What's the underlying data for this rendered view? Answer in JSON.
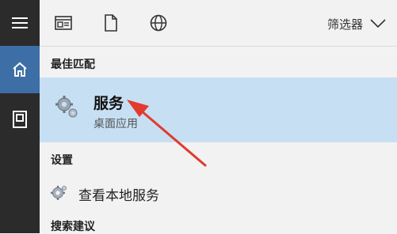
{
  "filter": {
    "label": "筛选器"
  },
  "sections": {
    "best_match": "最佳匹配",
    "settings": "设置",
    "search_suggestions": "搜索建议"
  },
  "best_match": {
    "title": "服务",
    "subtitle": "桌面应用"
  },
  "settings_items": [
    {
      "label": "查看本地服务"
    }
  ],
  "icons": {
    "rail": [
      "hamburger-menu-icon",
      "home-icon",
      "notebook-icon"
    ],
    "toolbar": [
      "apps-icon",
      "documents-icon",
      "web-globe-icon"
    ],
    "filter": "chevron-down-icon",
    "best_match": "gear-icon",
    "settings_item": "settings-gear-icon"
  },
  "colors": {
    "rail": "#2b2b2b",
    "rail_active": "#3d6fa6",
    "panel": "#f2f2f2",
    "selected": "#c6dff2",
    "arrow": "#e23b2e"
  }
}
